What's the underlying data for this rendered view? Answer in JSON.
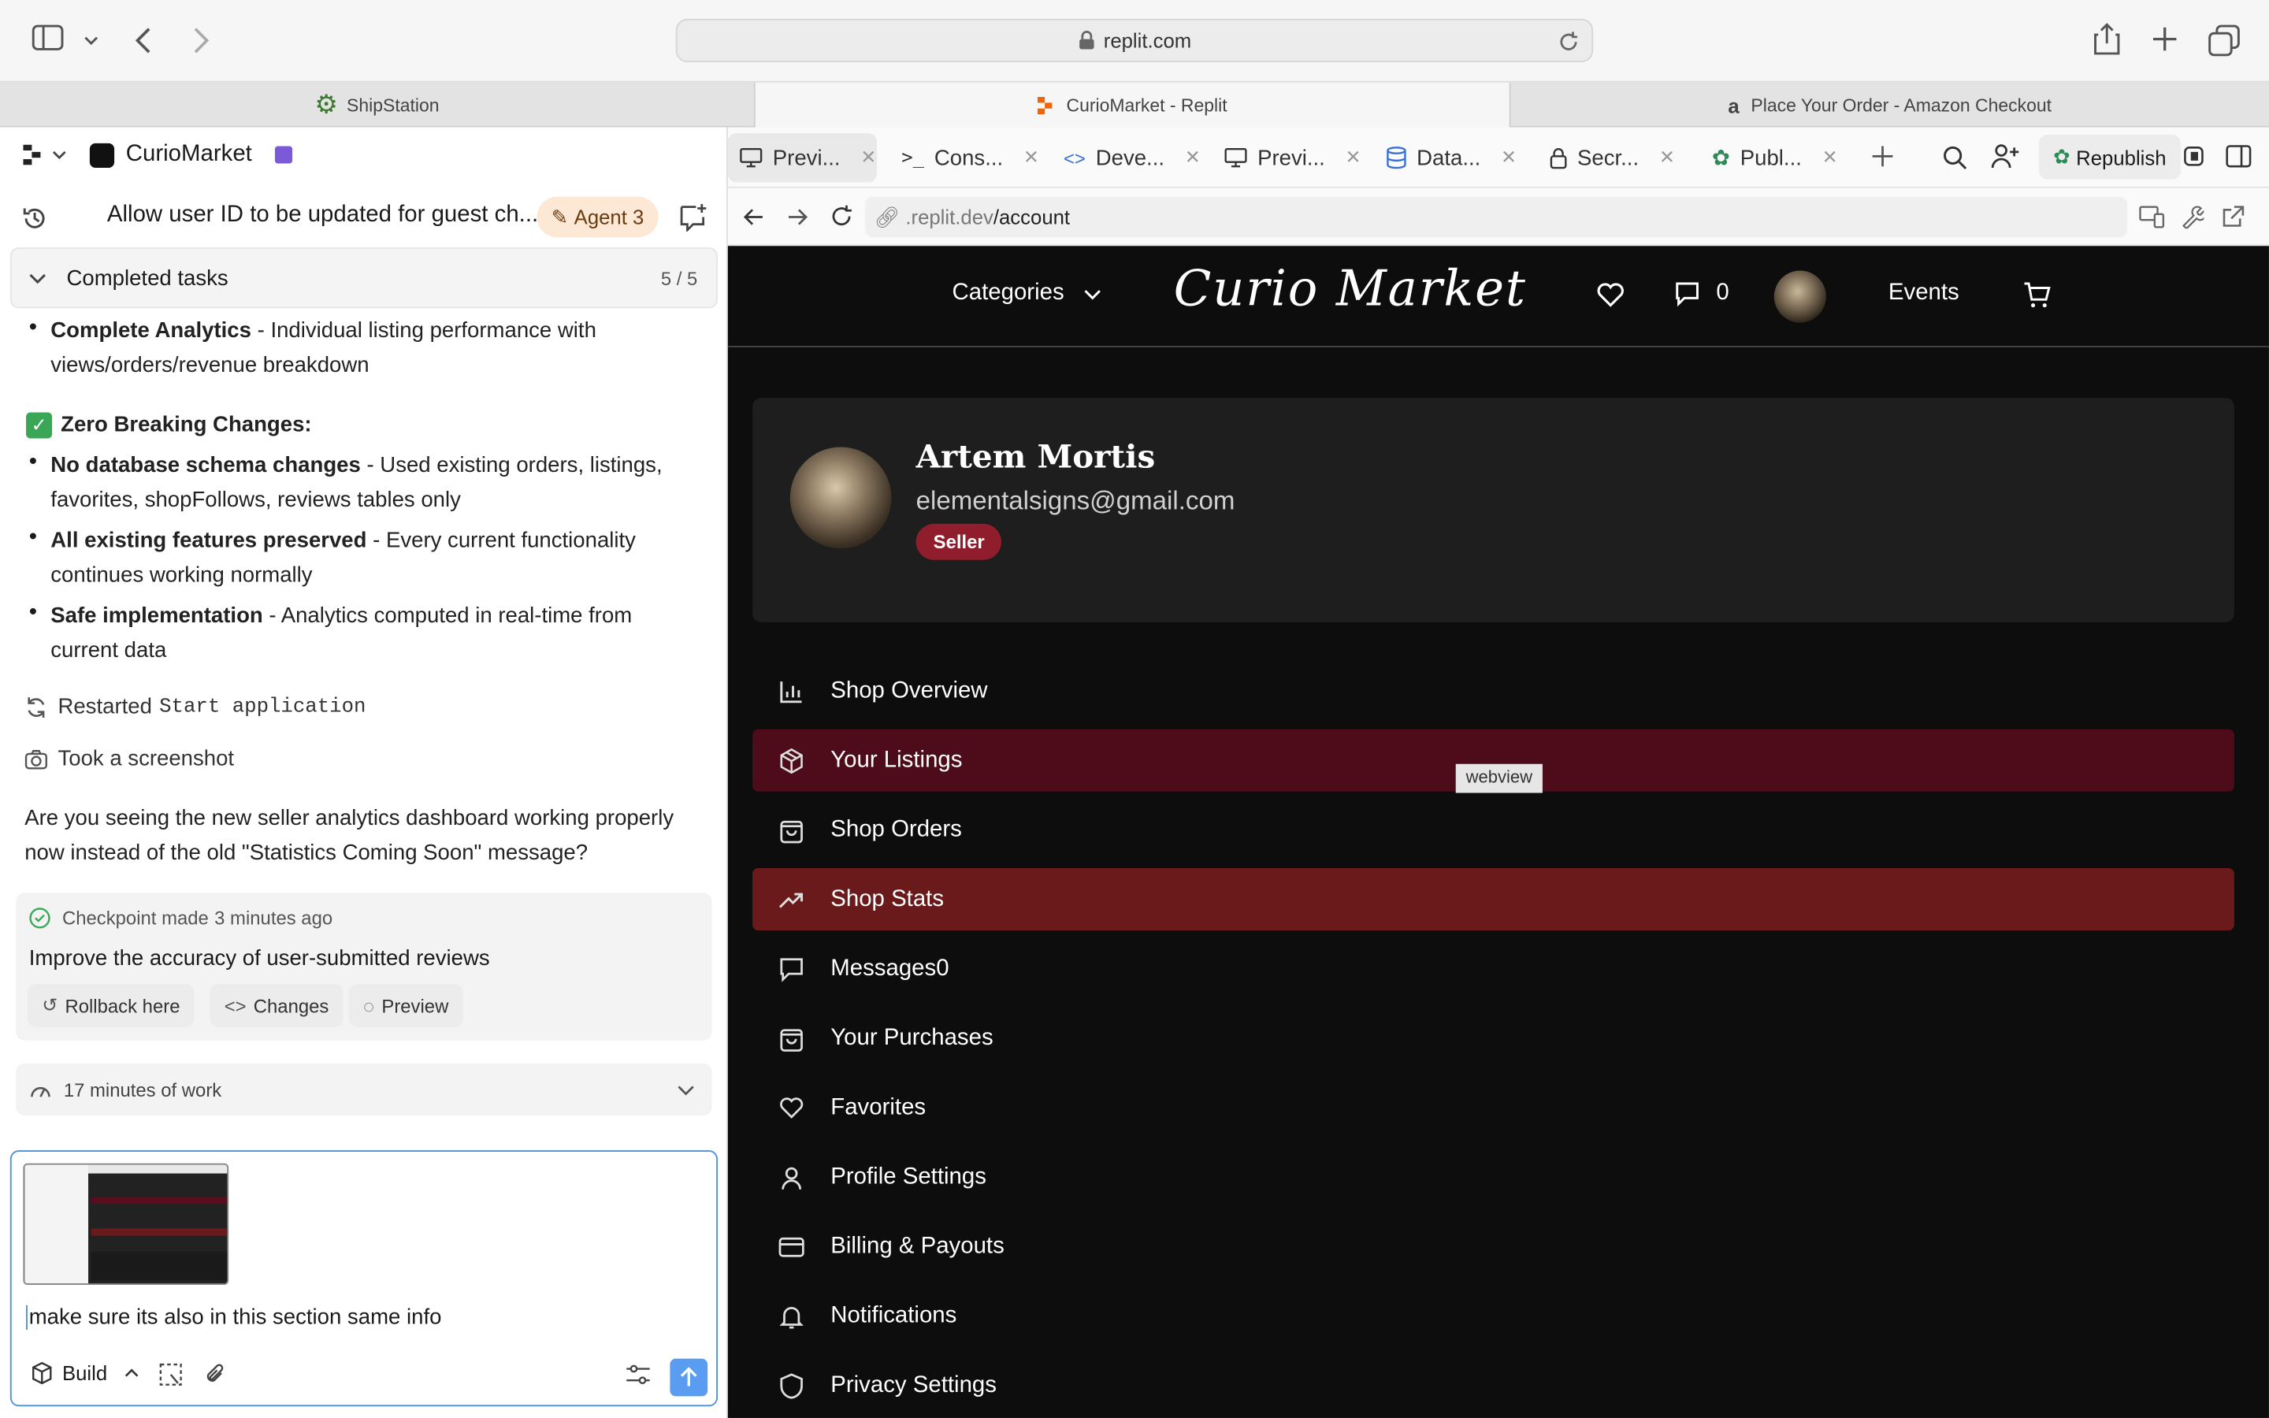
{
  "browser": {
    "url": "replit.com",
    "tabs": [
      {
        "label": "ShipStation"
      },
      {
        "label": "CurioMarket - Replit"
      },
      {
        "label": "Place Your Order - Amazon Checkout"
      }
    ]
  },
  "left": {
    "project_name": "CurioMarket",
    "thread_title": "Allow user ID to be updated for guest ch...",
    "agent_badge": "Agent 3",
    "tasks_header": "Completed tasks",
    "tasks_count": "5 / 5",
    "p1_bold": "Complete Analytics",
    "p1_rest": " - Individual listing performance with views/orders/revenue breakdown",
    "zero_heading": "Zero Breaking Changes:",
    "b1_bold": "No database schema changes",
    "b1_rest": " - Used existing orders, listings, favorites, shopFollows, reviews tables only",
    "b2_bold": "All existing features preserved",
    "b2_rest": " - Every current functionality continues working normally",
    "b3_bold": "Safe implementation",
    "b3_rest": " - Analytics computed in real-time from current data",
    "restarted_prefix": "Restarted",
    "restarted_cmd": "Start application",
    "screenshot_label": "Took a screenshot",
    "question": "Are you seeing the new seller analytics dashboard working properly now instead of the old \"Statistics Coming Soon\" message?",
    "checkpoint_label": "Checkpoint made",
    "checkpoint_time": "3 minutes ago",
    "checkpoint_desc": "Improve the accuracy of user-submitted reviews",
    "rollback_label": "Rollback here",
    "changes_label": "Changes",
    "preview_label": "Preview",
    "work_label": "17 minutes of work",
    "input_text": "make sure its also in this section same info",
    "build_label": "Build"
  },
  "ide_tabs": [
    {
      "label": "Previ..."
    },
    {
      "label": "Cons..."
    },
    {
      "label": "Deve..."
    },
    {
      "label": "Previ..."
    },
    {
      "label": "Data..."
    },
    {
      "label": "Secr..."
    },
    {
      "label": "Publ..."
    }
  ],
  "republish_label": "Republish",
  "inner_url": {
    "prefix": ".replit.dev",
    "path": "/account"
  },
  "site": {
    "categories_label": "Categories",
    "logo_text": "Curio Market",
    "messages_count": "0",
    "events_label": "Events",
    "user_name": "Artem Mortis",
    "user_email": "elementalsigns@gmail.com",
    "role_badge": "Seller",
    "webview_tooltip": "webview",
    "menu": [
      {
        "label": "Shop Overview",
        "icon": "bar-chart-icon"
      },
      {
        "label": "Your Listings",
        "icon": "package-icon"
      },
      {
        "label": "Shop Orders",
        "icon": "shopping-bag-icon"
      },
      {
        "label": "Shop Stats",
        "icon": "trending-up-icon"
      },
      {
        "label": "Messages0",
        "icon": "message-icon"
      },
      {
        "label": "Your Purchases",
        "icon": "shopping-bag-icon"
      },
      {
        "label": "Favorites",
        "icon": "heart-icon"
      },
      {
        "label": "Profile Settings",
        "icon": "user-icon"
      },
      {
        "label": "Billing & Payouts",
        "icon": "credit-card-icon"
      },
      {
        "label": "Notifications",
        "icon": "bell-icon"
      },
      {
        "label": "Privacy Settings",
        "icon": "shield-icon"
      }
    ]
  },
  "colors": {
    "listings_highlight": "#4e0b19",
    "stats_highlight": "#6b1a1c",
    "seller_badge": "#8f1d2c",
    "send_button": "#5a9cf0"
  }
}
